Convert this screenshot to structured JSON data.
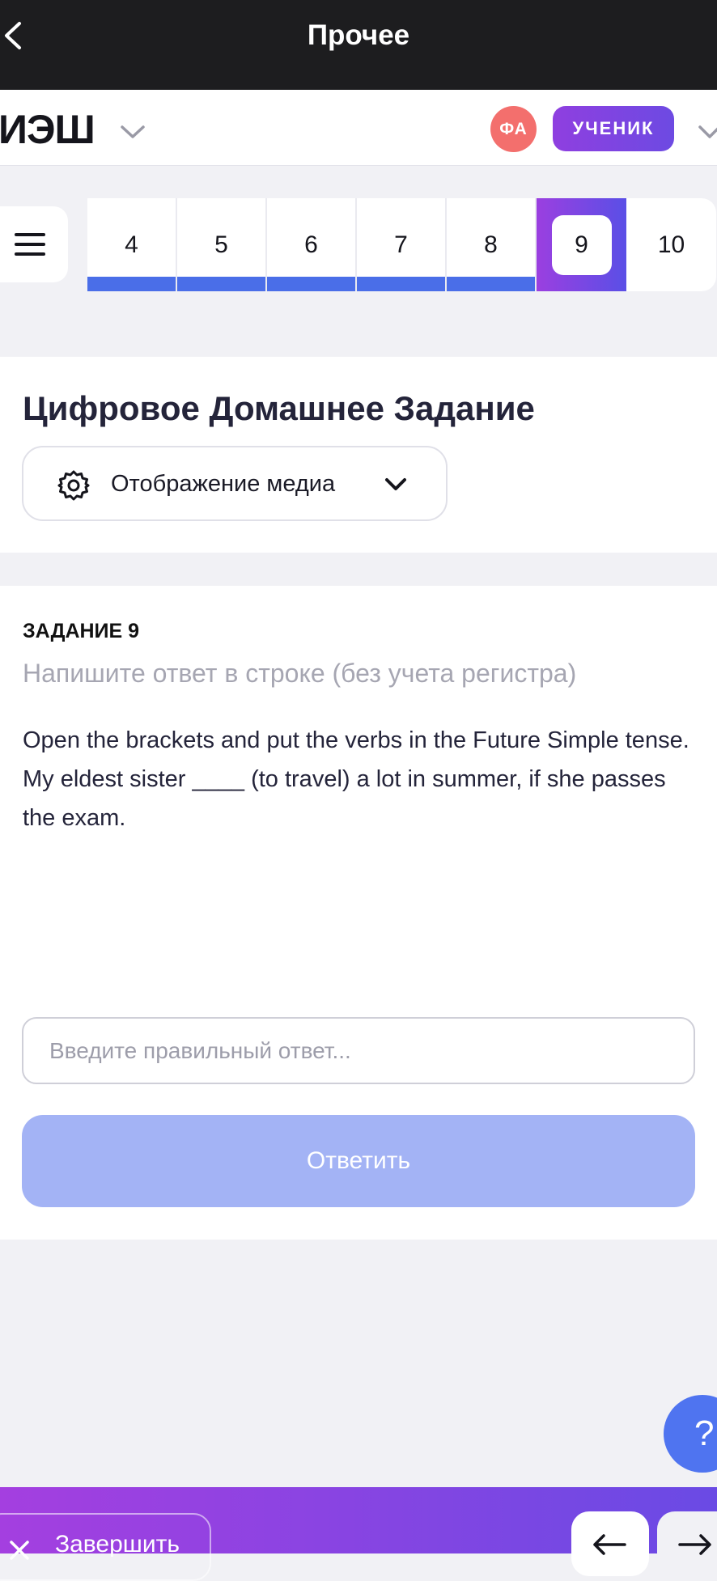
{
  "topbar": {
    "title": "Прочее"
  },
  "appbar": {
    "logo": "ИЭШ",
    "avatar_initials": "ФА",
    "role": "УЧЕНИК"
  },
  "tabs": [
    {
      "label": "4",
      "state": "done"
    },
    {
      "label": "5",
      "state": "done"
    },
    {
      "label": "6",
      "state": "done"
    },
    {
      "label": "7",
      "state": "done"
    },
    {
      "label": "8",
      "state": "done"
    },
    {
      "label": "9",
      "state": "active"
    },
    {
      "label": "10",
      "state": "pending"
    }
  ],
  "header_card": {
    "title": "Цифровое Домашнее Задание",
    "media_dropdown": "Отображение медиа"
  },
  "task": {
    "number": "ЗАДАНИЕ 9",
    "hint": "Напишите ответ в строке (без учета регистра)",
    "text_line1": "Open the brackets and put the verbs in the Future Simple tense.",
    "text_line2": "My eldest sister ____ (to travel) a lot in summer, if she passes the exam.",
    "input_placeholder": "Введите правильный ответ...",
    "input_value": "",
    "submit_label": "Ответить"
  },
  "help": {
    "label": "?"
  },
  "bottombar": {
    "finish_label": "Завершить"
  },
  "colors": {
    "accent_purple": "#8f3fe0",
    "progress_blue": "#4a6ee8",
    "submit_disabled": "#a3b3f5",
    "avatar": "#f36f6d"
  },
  "icons": [
    "back-icon",
    "chevron-down-icon",
    "menu-icon",
    "gear-icon",
    "close-icon",
    "arrow-left-icon",
    "arrow-right-icon"
  ]
}
